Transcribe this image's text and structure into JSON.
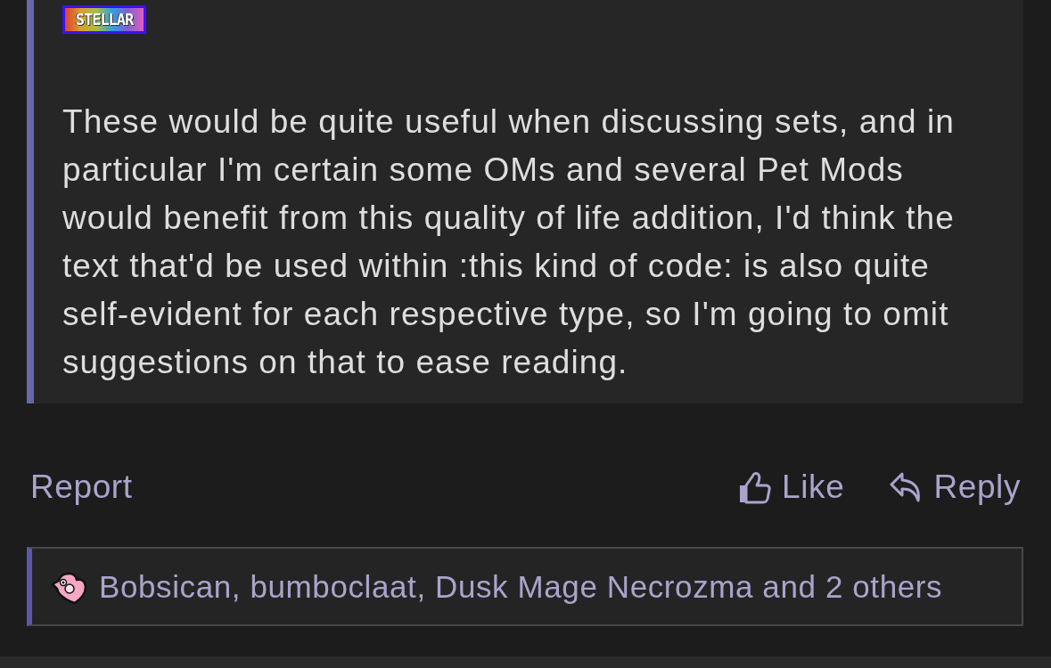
{
  "post": {
    "badge": "STELLAR",
    "body": "These would be quite useful when discussing sets, and in particular I'm certain some OMs and several Pet Mods would benefit from this quality of life addition, I'd think the text that'd be used within :this kind of code: is also quite self-evident for each respective type, so I'm going to omit suggestions on that to ease reading."
  },
  "actions": [
    {
      "kind": "report",
      "label": "Report"
    },
    {
      "kind": "like",
      "label": "Like"
    },
    {
      "kind": "reply",
      "label": "Reply"
    }
  ],
  "reactions": {
    "summary": "Bobsican, bumboclaat, Dusk Mage Necrozma and 2 others"
  }
}
